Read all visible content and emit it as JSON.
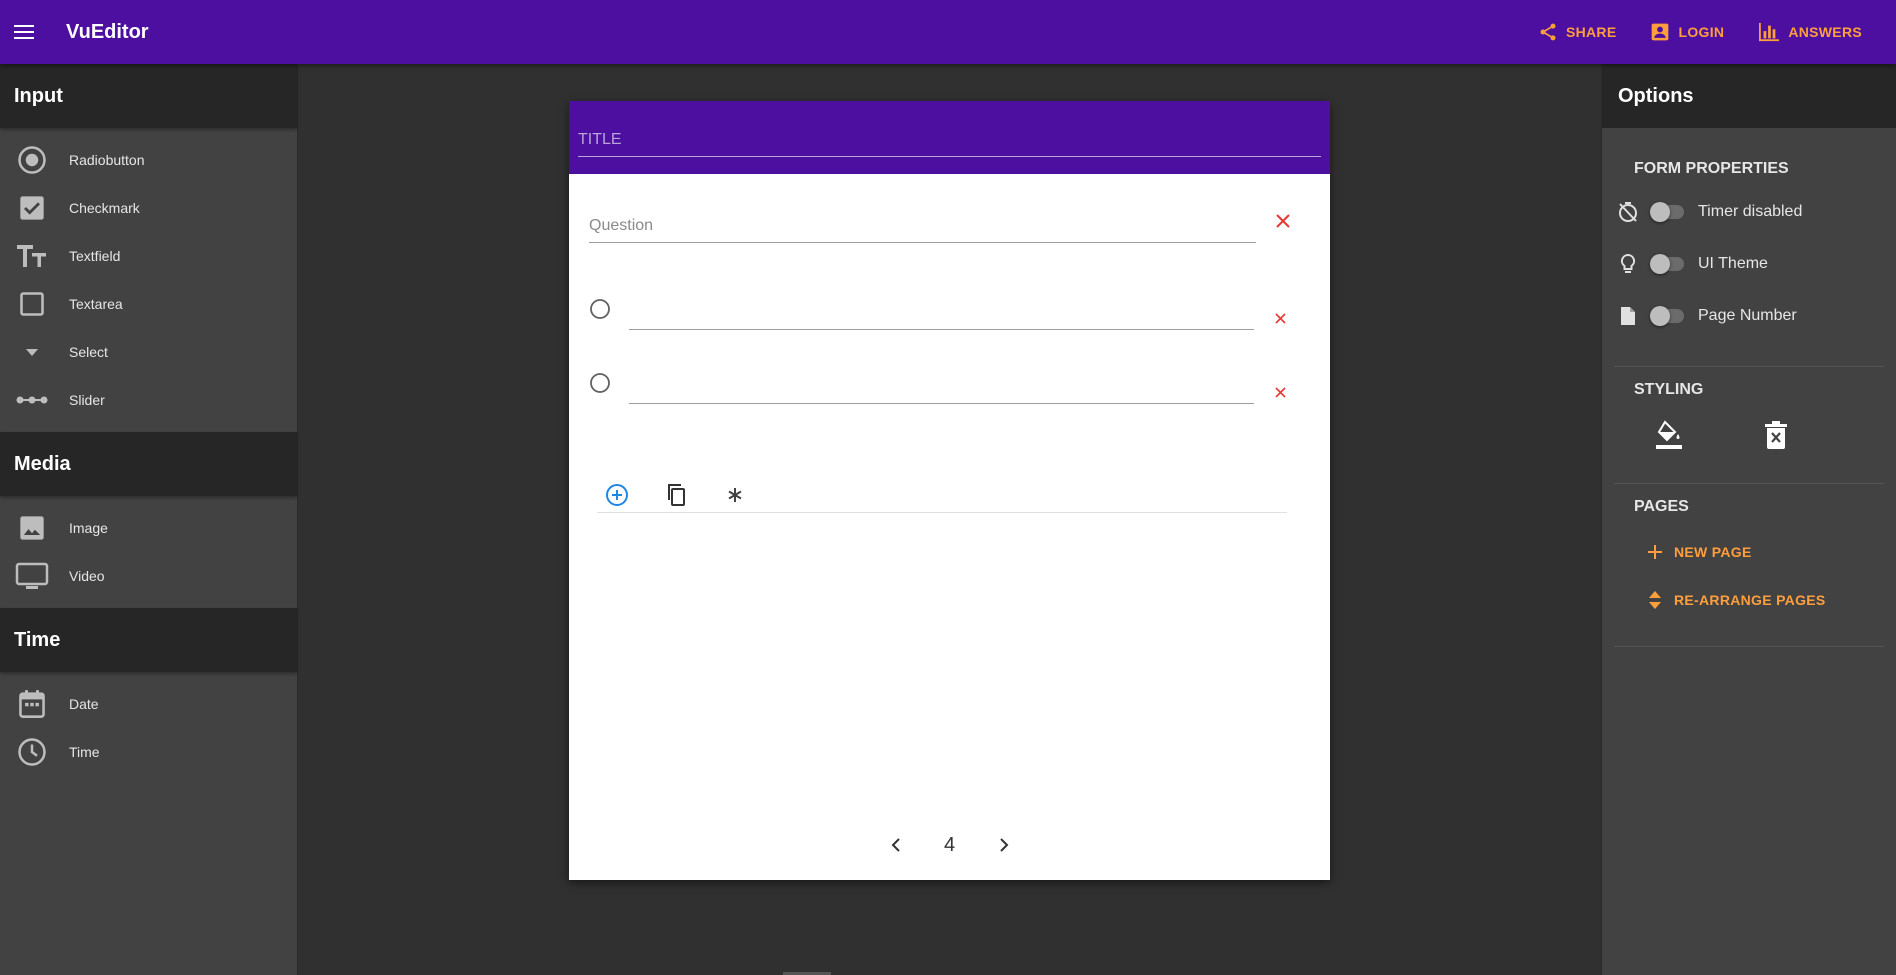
{
  "app": {
    "title": "VuEditor"
  },
  "top_actions": [
    {
      "label": "SHARE",
      "icon": "share-icon"
    },
    {
      "label": "LOGIN",
      "icon": "account-box-icon"
    },
    {
      "label": "ANSWERS",
      "icon": "bar-chart-icon"
    }
  ],
  "left_panel": {
    "sections": [
      {
        "title": "Input",
        "items": [
          {
            "label": "Radiobutton",
            "icon": "radio-button-icon"
          },
          {
            "label": "Checkmark",
            "icon": "checkbox-icon"
          },
          {
            "label": "Textfield",
            "icon": "text-fields-icon"
          },
          {
            "label": "Textarea",
            "icon": "square-outline-icon"
          },
          {
            "label": "Select",
            "icon": "dropdown-arrow-icon"
          },
          {
            "label": "Slider",
            "icon": "slider-icon"
          }
        ]
      },
      {
        "title": "Media",
        "items": [
          {
            "label": "Image",
            "icon": "image-icon"
          },
          {
            "label": "Video",
            "icon": "monitor-icon"
          }
        ]
      },
      {
        "title": "Time",
        "items": [
          {
            "label": "Date",
            "icon": "calendar-icon"
          },
          {
            "label": "Time",
            "icon": "clock-icon"
          }
        ]
      }
    ]
  },
  "form": {
    "title_placeholder": "TITLE",
    "question_placeholder": "Question",
    "options": [
      "",
      ""
    ],
    "page_number": "4"
  },
  "right_panel": {
    "title": "Options",
    "form_properties": {
      "title": "FORM PROPERTIES",
      "toggles": [
        {
          "label": "Timer disabled",
          "icon": "timer-off-icon",
          "on": false
        },
        {
          "label": "UI Theme",
          "icon": "lightbulb-icon",
          "on": false
        },
        {
          "label": "Page Number",
          "icon": "file-icon",
          "on": false
        }
      ]
    },
    "styling": {
      "title": "STYLING"
    },
    "pages": {
      "title": "PAGES",
      "new_page": "NEW PAGE",
      "rearrange": "RE-ARRANGE PAGES"
    }
  },
  "colors": {
    "primary": "#4c0f9f",
    "accent": "#ff9e3d",
    "danger": "#e53935",
    "link": "#1e88e5"
  }
}
